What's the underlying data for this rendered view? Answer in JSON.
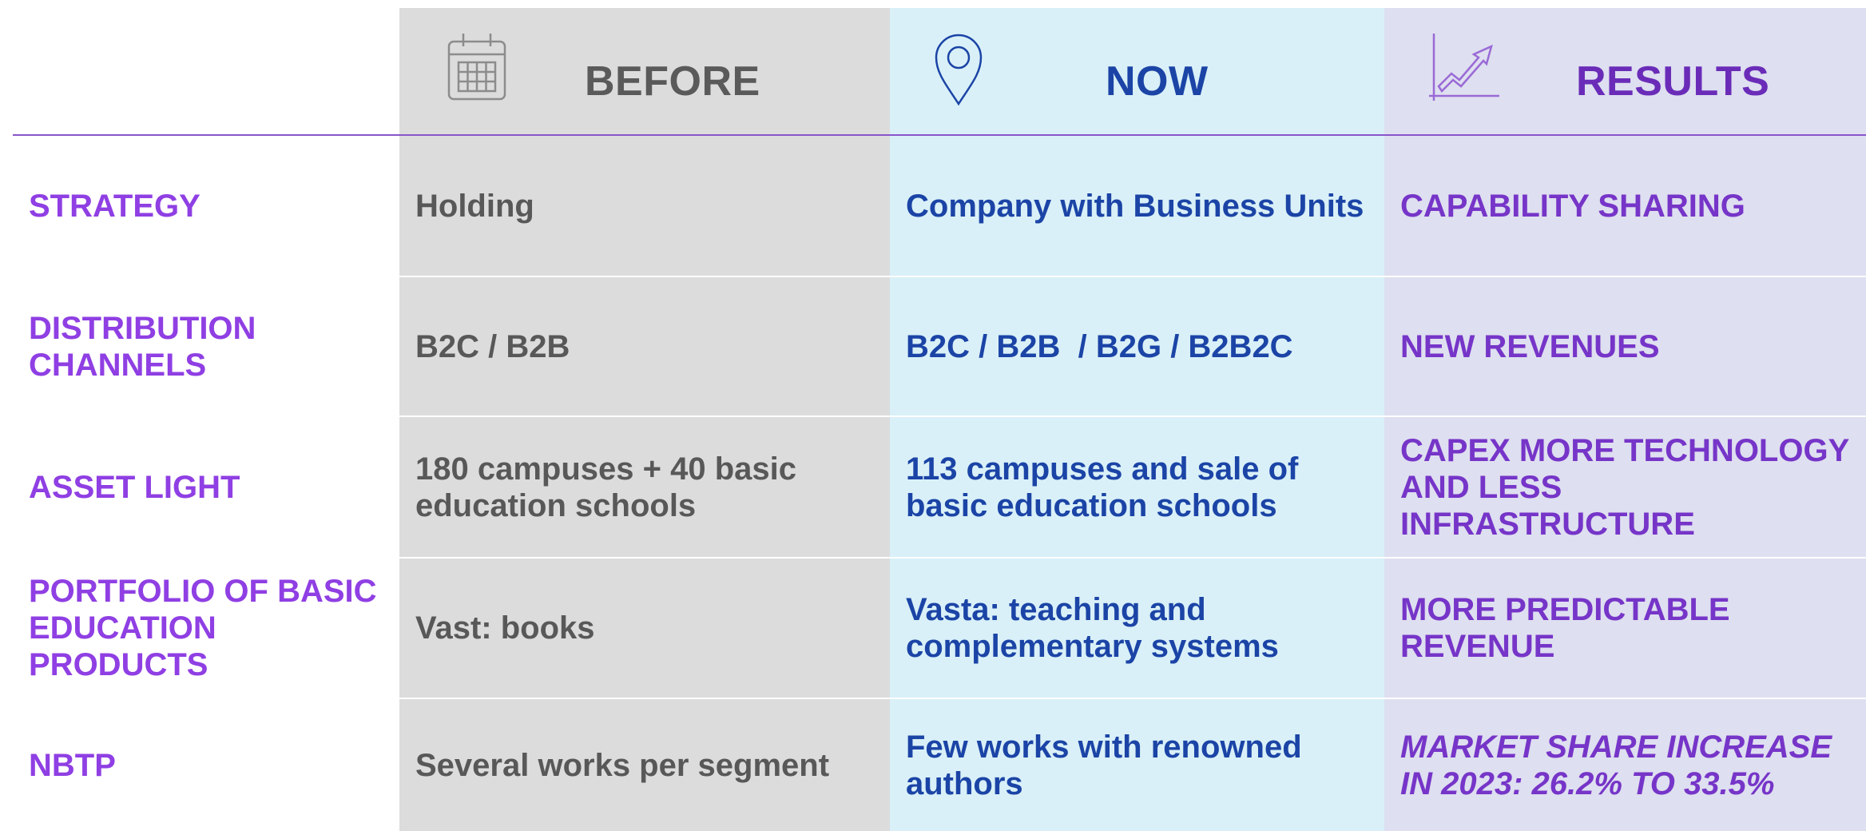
{
  "columns": {
    "before": {
      "title": "BEFORE",
      "icon": "calendar-icon"
    },
    "now": {
      "title": "NOW",
      "icon": "location-pin-icon"
    },
    "results": {
      "title": "RESULTS",
      "icon": "growth-chart-icon"
    }
  },
  "colors": {
    "label_purple": "#8f3fe3",
    "before_gray": "#585858",
    "now_blue": "#1b44a6",
    "results_purple": "#7635c8",
    "header_rule": "#8a55c9"
  },
  "rows": [
    {
      "label": "STRATEGY",
      "before": "Holding",
      "now": "Company with Business Units",
      "result": "CAPABILITY SHARING"
    },
    {
      "label": "DISTRIBUTION CHANNELS",
      "before": "B2C / B2B",
      "now": "B2C / B2B  / B2G / B2B2C",
      "result": "NEW REVENUES"
    },
    {
      "label": "ASSET LIGHT",
      "before": "180 campuses + 40 basic education schools",
      "now": "113 campuses and sale of basic education schools",
      "result": "CAPEX MORE TECHNOLOGY AND LESS INFRASTRUCTURE"
    },
    {
      "label": "PORTFOLIO OF BASIC EDUCATION PRODUCTS",
      "before": "Vast: books",
      "now": "Vasta: teaching and complementary systems",
      "result": "MORE PREDICTABLE REVENUE"
    },
    {
      "label": "NBTP",
      "before": "Several works per segment",
      "now": "Few works with renowned authors",
      "result": "MARKET SHARE INCREASE IN 2023: 26.2% TO 33.5%"
    }
  ]
}
